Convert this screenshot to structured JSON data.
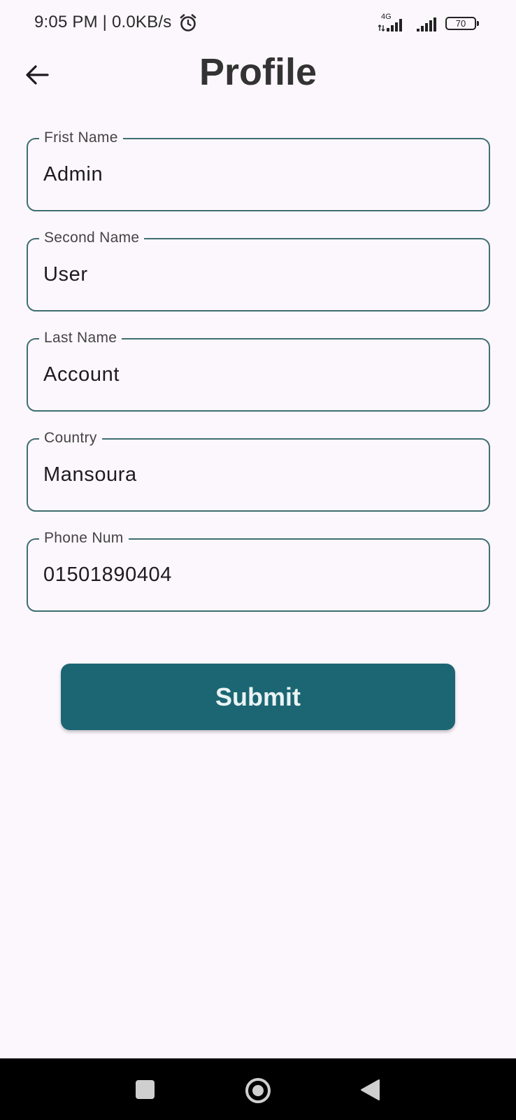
{
  "status_bar": {
    "time_speed": "9:05 PM | 0.0KB/s",
    "network_type": "4G",
    "battery_level": "70"
  },
  "header": {
    "title": "Profile"
  },
  "form": {
    "fields": [
      {
        "label": "Frist Name",
        "value": "Admin"
      },
      {
        "label": "Second Name",
        "value": "User"
      },
      {
        "label": "Last Name",
        "value": "Account"
      },
      {
        "label": "Country",
        "value": "Mansoura"
      },
      {
        "label": "Phone Num",
        "value": "01501890404"
      }
    ],
    "submit_label": "Submit"
  },
  "colors": {
    "background": "#fcf7fd",
    "accent": "#1b6672",
    "field_border": "#3f6e72",
    "title": "#333333"
  }
}
